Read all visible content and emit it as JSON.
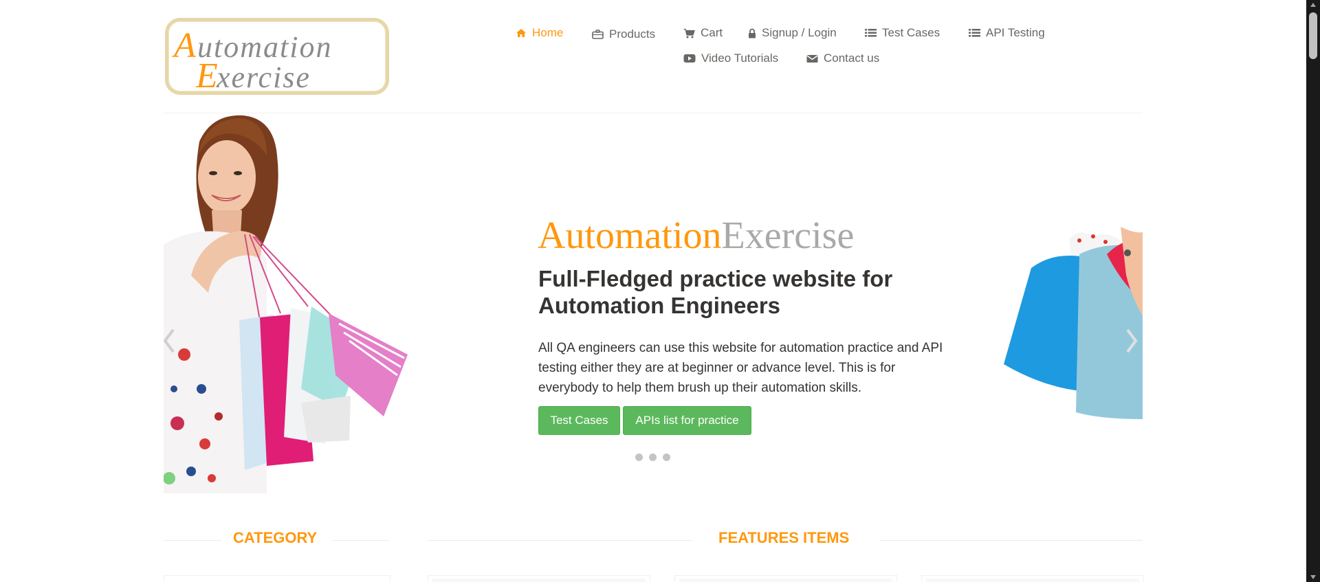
{
  "logo": {
    "line1_first": "A",
    "line1_rest": "utomation",
    "line2_first": "E",
    "line2_rest": "xercise",
    "accent_color": "#FE980F"
  },
  "nav": {
    "items": [
      {
        "label": "Home",
        "icon": "home-icon",
        "active": true
      },
      {
        "label": "Products",
        "icon": "briefcase-icon"
      },
      {
        "label": "Cart",
        "icon": "cart-icon"
      },
      {
        "label": "Signup / Login",
        "icon": "lock-icon"
      },
      {
        "label": "Test Cases",
        "icon": "list-icon"
      },
      {
        "label": "API Testing",
        "icon": "list-icon"
      },
      {
        "label": "Video Tutorials",
        "icon": "youtube-play-icon"
      },
      {
        "label": "Contact us",
        "icon": "envelope-icon"
      }
    ]
  },
  "slider": {
    "brand_part1": "Automation",
    "brand_part2": "Exercise",
    "title": "Full-Fledged practice website for Automation Engineers",
    "text": "All QA engineers can use this website for automation practice and API testing either they are at beginner or advance level. This is for everybody to help them brush up their automation skills.",
    "button1": "Test Cases",
    "button2": "APIs list for practice",
    "indicator_count": 3,
    "button_color": "#5cb85c"
  },
  "sections": {
    "category": "CATEGORY",
    "features": "FEATURES ITEMS"
  },
  "colors": {
    "accent": "#FE980F",
    "text": "#696763",
    "heading": "#363432"
  }
}
